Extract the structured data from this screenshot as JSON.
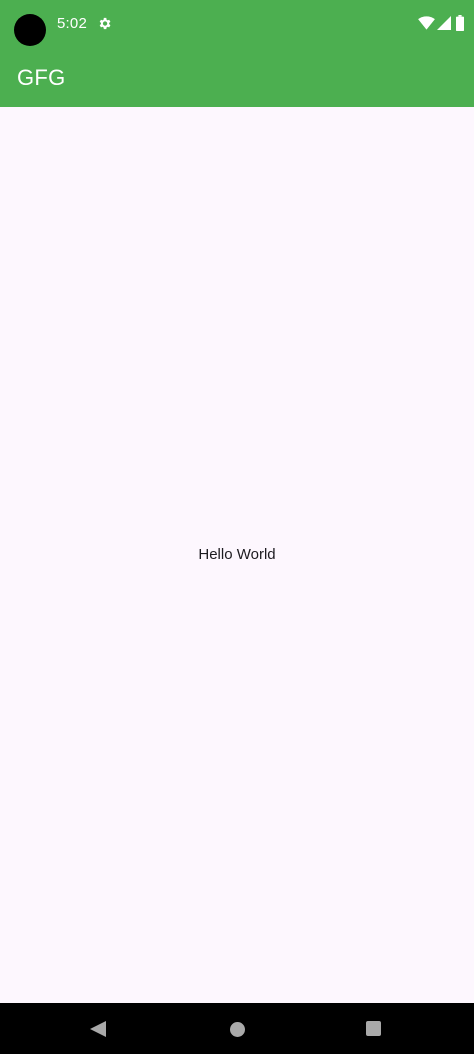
{
  "status_bar": {
    "time": "5:02",
    "icons": [
      "camera-cutout",
      "gear-icon",
      "wifi-icon",
      "signal-icon",
      "battery-icon"
    ]
  },
  "app_bar": {
    "title": "GFG",
    "color": "#4caf50"
  },
  "main": {
    "text": "Hello World",
    "background": "#fdf7fe"
  },
  "nav_bar": {
    "buttons": [
      "back-icon",
      "home-icon",
      "recents-icon"
    ]
  }
}
